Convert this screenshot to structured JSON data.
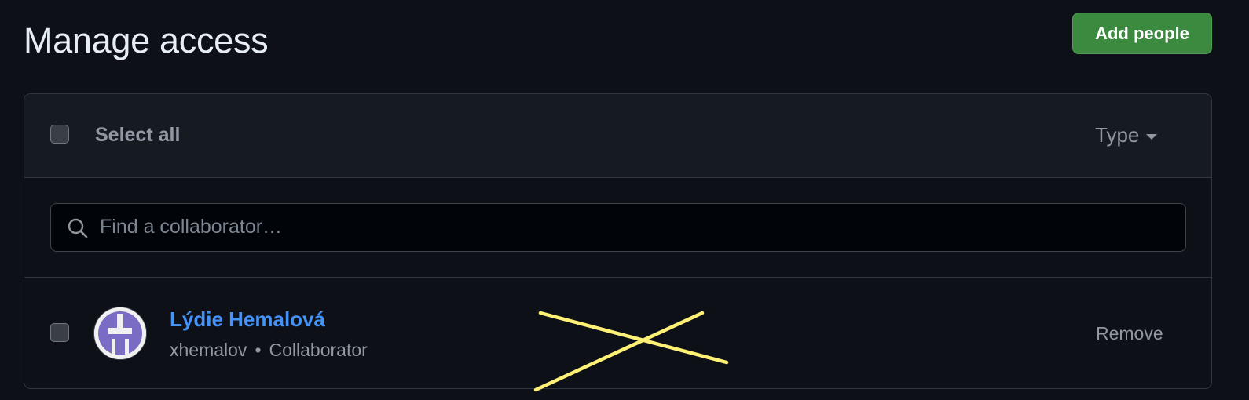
{
  "header": {
    "title": "Manage access",
    "add_button_label": "Add people"
  },
  "toolbar": {
    "select_all_label": "Select all",
    "type_filter_label": "Type"
  },
  "search": {
    "placeholder": "Find a collaborator…",
    "value": ""
  },
  "members": [
    {
      "name": "Lýdie Hemalová",
      "username": "xhemalov",
      "separator": "•",
      "role": "Collaborator",
      "action_label": "Remove",
      "avatar_color": "#7a6bc4",
      "checked": false
    }
  ],
  "colors": {
    "accent_link": "#4493f8",
    "primary_button": "#3c8a3f",
    "annotation_stroke": "#fff176"
  },
  "icons": {
    "search": "search-icon",
    "caret": "caret-down-icon"
  }
}
